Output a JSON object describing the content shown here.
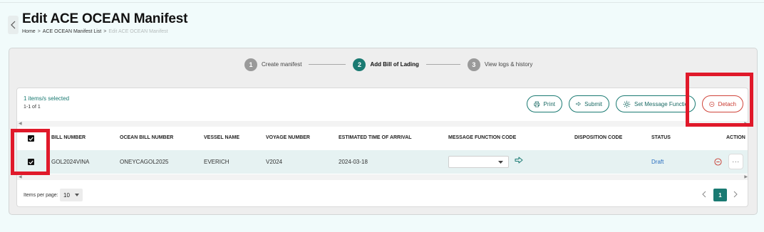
{
  "header": {
    "title": "Edit ACE OCEAN Manifest",
    "breadcrumb": [
      {
        "label": "Home"
      },
      {
        "label": "ACE OCEAN Manifest List"
      },
      {
        "label": "Edit ACE OCEAN Manifest"
      }
    ],
    "separator": ">"
  },
  "stepper": [
    {
      "num": "1",
      "label": "Create manifest",
      "state": "done"
    },
    {
      "num": "2",
      "label": "Add Bill of Lading",
      "state": "active"
    },
    {
      "num": "3",
      "label": "View logs & history",
      "state": "pending"
    }
  ],
  "selection": {
    "selected_text": "1 items/s selected",
    "count_text": "1-1 of 1"
  },
  "actions": {
    "print": "Print",
    "submit": "Submit",
    "set_message_function": "Set Message Functio",
    "detach": "Detach"
  },
  "table": {
    "columns": [
      "BILL NUMBER",
      "OCEAN BILL NUMBER",
      "VESSEL NAME",
      "VOYAGE NUMBER",
      "ESTIMATED TIME OF ARRIVAL",
      "MESSAGE FUNCTION CODE",
      "DISPOSITION CODE",
      "STATUS",
      "ACTION"
    ],
    "rows": [
      {
        "checked": true,
        "bill_number": "GOL2024VINA",
        "ocean_bill_number": "ONEYCAGOL2025",
        "vessel_name": "EVERICH",
        "voyage_number": "V2024",
        "eta": "2024-03-18",
        "message_function_code": "",
        "disposition_code": "",
        "status": "Draft"
      }
    ]
  },
  "footer": {
    "items_per_page_label": "Items per page:",
    "items_per_page": "10",
    "current_page": "1"
  },
  "colors": {
    "accent": "#1a7a72",
    "danger": "#c9382e",
    "annotation": "#e0192a",
    "status_link": "#2a6fc0"
  },
  "icons": [
    "chevron-left-icon",
    "printer-icon",
    "arrow-right-outline-icon",
    "gear-icon",
    "minus-circle-icon",
    "check-icon",
    "caret-down-icon",
    "more-icon",
    "chevron-right-icon"
  ]
}
